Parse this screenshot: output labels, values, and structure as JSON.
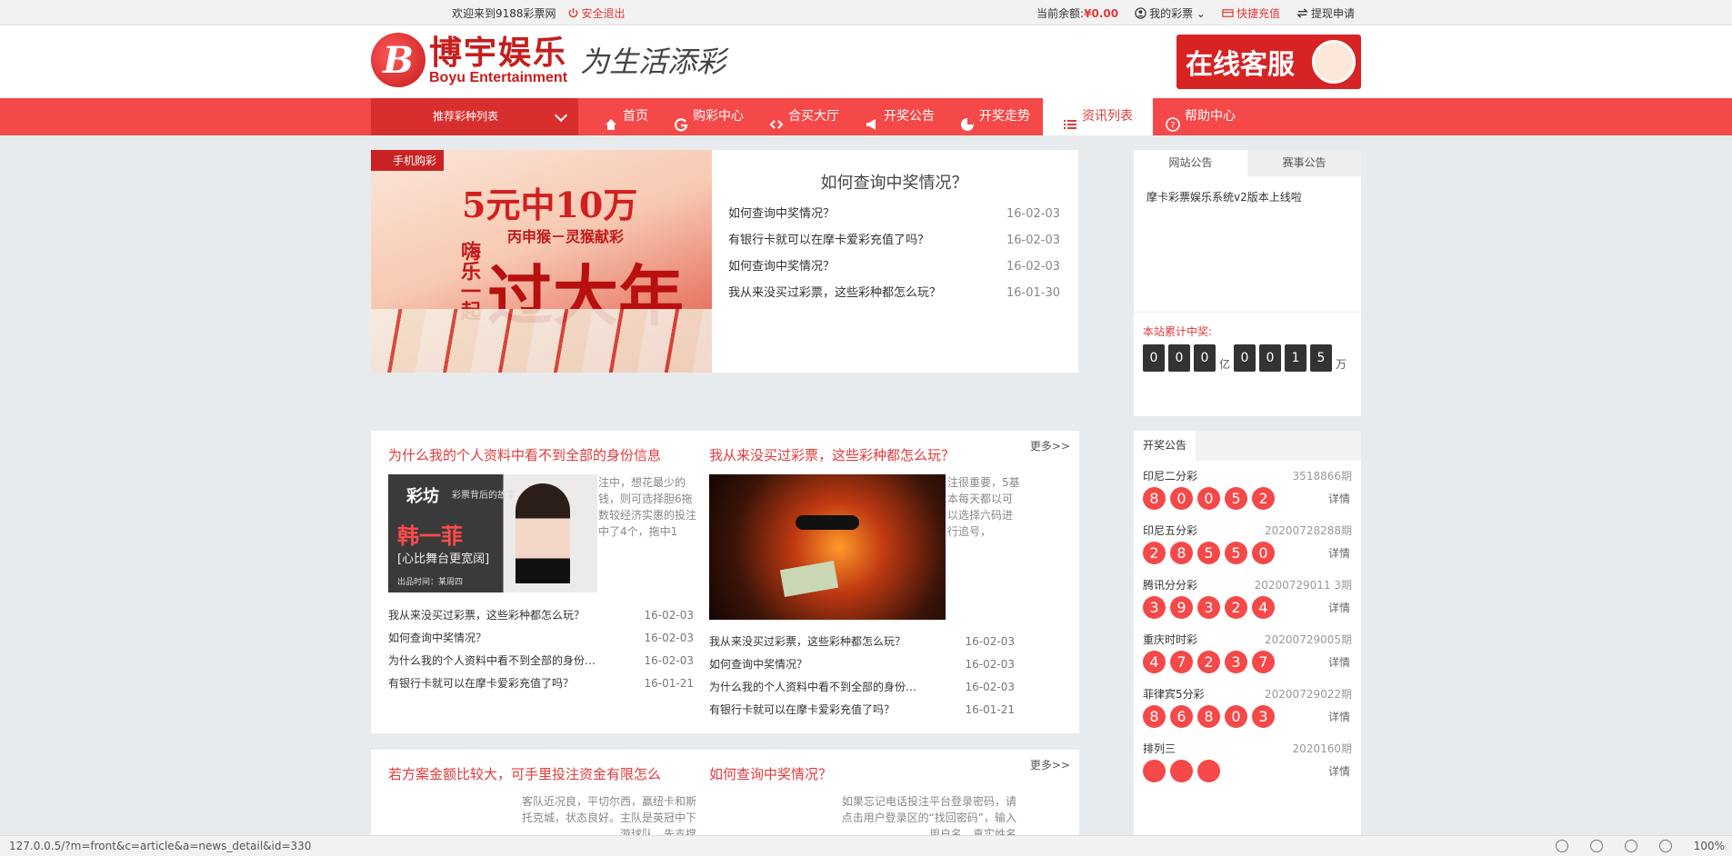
{
  "topbar": {
    "welcome": "欢迎来到9188彩票网",
    "logout": "安全退出",
    "balance_label": "当前余额:",
    "balance_value": "¥0.00",
    "my_lottery": "我的彩票",
    "quick_recharge": "快捷充值",
    "withdraw": "提现申请"
  },
  "header": {
    "logo_cn": "博宇娱乐",
    "logo_en": "Boyu Entertainment",
    "slogan": "为生活添彩",
    "service": "在线客服"
  },
  "nav": {
    "category": "推荐彩种列表",
    "items": [
      {
        "label": "首页",
        "icon": "home-icon"
      },
      {
        "label": "购彩中心",
        "icon": "g-icon"
      },
      {
        "label": "合买大厅",
        "icon": "link-icon"
      },
      {
        "label": "开奖公告",
        "icon": "megaphone-icon"
      },
      {
        "label": "开奖走势",
        "icon": "pie-icon"
      },
      {
        "label": "资讯列表",
        "icon": "list-icon"
      },
      {
        "label": "帮助中心",
        "icon": "question-icon"
      }
    ]
  },
  "banner": {
    "tag": "手机购彩",
    "headline": "5元中10万",
    "sub": "丙申猴－灵猴献彩",
    "side": "嗨乐一起",
    "year": "过大年"
  },
  "featured": {
    "title": "如何查询中奖情况？",
    "items": [
      {
        "title": "如何查询中奖情况？",
        "date": "16-02-03"
      },
      {
        "title": "有银行卡就可以在摩卡爱彩充值了吗？",
        "date": "16-02-03"
      },
      {
        "title": "如何查询中奖情况？",
        "date": "16-02-03"
      },
      {
        "title": "我从来没买过彩票，这些彩种都怎么玩？",
        "date": "16-01-30"
      }
    ]
  },
  "notice": {
    "tabs": [
      "网站公告",
      "赛事公告"
    ],
    "items": [
      "摩卡彩票娱乐系统v2版本上线啦"
    ],
    "total_label": "本站累计中奖:",
    "digits_yi": [
      "0",
      "0",
      "0"
    ],
    "unit_yi": "亿",
    "digits_wan": [
      "0",
      "0",
      "1",
      "5"
    ],
    "unit_wan": "万"
  },
  "news1": {
    "more": "更多>>",
    "left": {
      "title": "为什么我的个人资料中看不到全部的身份信息",
      "excerpt": "注中，想花最少的钱，则可选择胆6拖数较经济实惠的投注中了4个，拖中1",
      "thumb": {
        "brand": "彩坊",
        "caption": "彩票背后的故事",
        "name": "韩一菲",
        "quote": "[心比舞台更宽阔]",
        "footer": "出品时间：某周四"
      },
      "items": [
        {
          "title": "我从来没买过彩票，这些彩种都怎么玩？",
          "date": "16-02-03"
        },
        {
          "title": "如何查询中奖情况？",
          "date": "16-02-03"
        },
        {
          "title": "为什么我的个人资料中看不到全部的身份信息",
          "date": "16-02-03"
        },
        {
          "title": "有银行卡就可以在摩卡爱彩充值了吗？",
          "date": "16-01-21"
        }
      ]
    },
    "right": {
      "title": "我从来没买过彩票，这些彩种都怎么玩？",
      "excerpt": "注很重要，5基本每天都以可以选择六码进行追号，",
      "items": [
        {
          "title": "我从来没买过彩票，这些彩种都怎么玩？",
          "date": "16-02-03"
        },
        {
          "title": "如何查询中奖情况？",
          "date": "16-02-03"
        },
        {
          "title": "为什么我的个人资料中看不到全部的身份信息",
          "date": "16-02-03"
        },
        {
          "title": "有银行卡就可以在摩卡爱彩充值了吗？",
          "date": "16-01-21"
        }
      ]
    }
  },
  "news2": {
    "more": "更多>>",
    "left": {
      "title": "若方案金额比较大，可手里投注资金有限怎么",
      "excerpt": "客队近况良，平切尔西，赢纽卡和斯托克城，状态良好。主队是英冠中下游球队，先支撑"
    },
    "right": {
      "title": "如何查询中奖情况？",
      "excerpt": "如果忘记电话投注平台登录密码，请点击用户登录区的“找回密码”，输入用户名、真实姓名"
    }
  },
  "lottery": {
    "tab": "开奖公告",
    "detail_label": "详情",
    "rows": [
      {
        "name": "印尼二分彩",
        "period": "3518866期",
        "balls": [
          "8",
          "0",
          "0",
          "5",
          "2"
        ]
      },
      {
        "name": "印尼五分彩",
        "period": "20200728288期",
        "balls": [
          "2",
          "8",
          "5",
          "5",
          "0"
        ]
      },
      {
        "name": "腾讯分分彩",
        "period": "20200729011 3期",
        "balls": [
          "3",
          "9",
          "3",
          "2",
          "4"
        ]
      },
      {
        "name": "重庆时时彩",
        "period": "20200729005期",
        "balls": [
          "4",
          "7",
          "2",
          "3",
          "7"
        ]
      },
      {
        "name": "菲律宾5分彩",
        "period": "20200729022期",
        "balls": [
          "8",
          "6",
          "8",
          "0",
          "3"
        ]
      },
      {
        "name": "排列三",
        "period": "2020160期",
        "balls": [
          "",
          "",
          ""
        ]
      }
    ]
  },
  "statusbar": {
    "url": "127.0.0.5/?m=front&c=article&a=news_detail&id=330",
    "zoom": "100%"
  },
  "colors": {
    "brand_red": "#f54848",
    "dark_red": "#d82e2e"
  }
}
